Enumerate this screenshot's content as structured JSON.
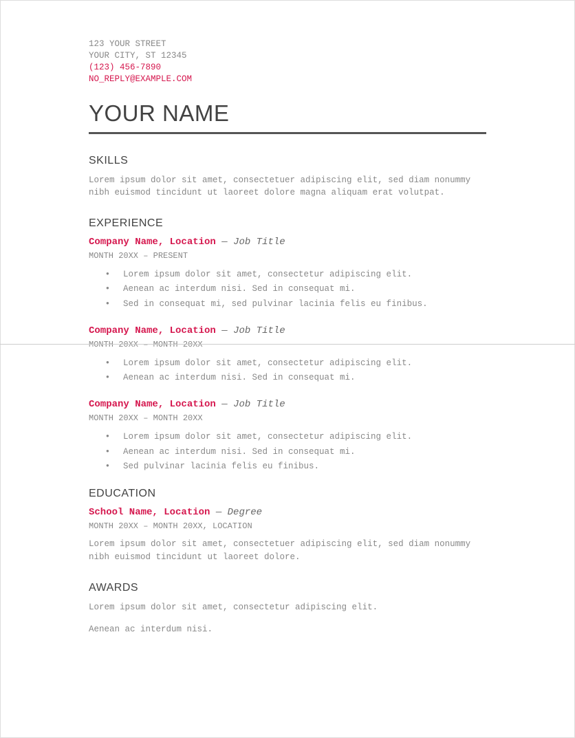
{
  "contact": {
    "street": "123 YOUR STREET",
    "city": "YOUR CITY, ST 12345",
    "phone": "(123) 456-7890",
    "email": "NO_REPLY@EXAMPLE.COM"
  },
  "name": "YOUR NAME",
  "sections": {
    "skills": {
      "heading": "SKILLS",
      "text": "Lorem ipsum dolor sit amet, consectetuer adipiscing elit, sed diam nonummy nibh euismod tincidunt ut laoreet dolore magna aliquam erat volutpat."
    },
    "experience": {
      "heading": "EXPERIENCE",
      "jobs": [
        {
          "company": "Company Name, Location",
          "sep": " — ",
          "role": "Job Title",
          "date": "MONTH 20XX – PRESENT",
          "bullets": [
            "Lorem ipsum dolor sit amet, consectetur adipiscing elit.",
            "Aenean ac interdum nisi. Sed in consequat mi.",
            "Sed in consequat mi, sed pulvinar lacinia felis eu finibus."
          ]
        },
        {
          "company": "Company Name, Location",
          "sep": " — ",
          "role": "Job Title",
          "date": "MONTH 20XX – MONTH 20XX",
          "bullets": [
            "Lorem ipsum dolor sit amet, consectetur adipiscing elit.",
            "Aenean ac interdum nisi. Sed in consequat mi."
          ]
        },
        {
          "company": "Company Name, Location",
          "sep": " — ",
          "role": "Job Title",
          "date": "MONTH 20XX – MONTH 20XX",
          "bullets": [
            "Lorem ipsum dolor sit amet, consectetur adipiscing elit.",
            "Aenean ac interdum nisi. Sed in consequat mi.",
            "Sed pulvinar lacinia felis eu finibus."
          ]
        }
      ]
    },
    "education": {
      "heading": "EDUCATION",
      "school": "School Name, Location",
      "sep": " — ",
      "degree": "Degree",
      "date": "MONTH 20XX – MONTH 20XX, LOCATION",
      "text": "Lorem ipsum dolor sit amet, consectetuer adipiscing elit, sed diam nonummy nibh euismod tincidunt ut laoreet dolore."
    },
    "awards": {
      "heading": "AWARDS",
      "lines": [
        "Lorem ipsum dolor sit amet, consectetur adipiscing elit.",
        "Aenean ac interdum nisi."
      ]
    }
  }
}
